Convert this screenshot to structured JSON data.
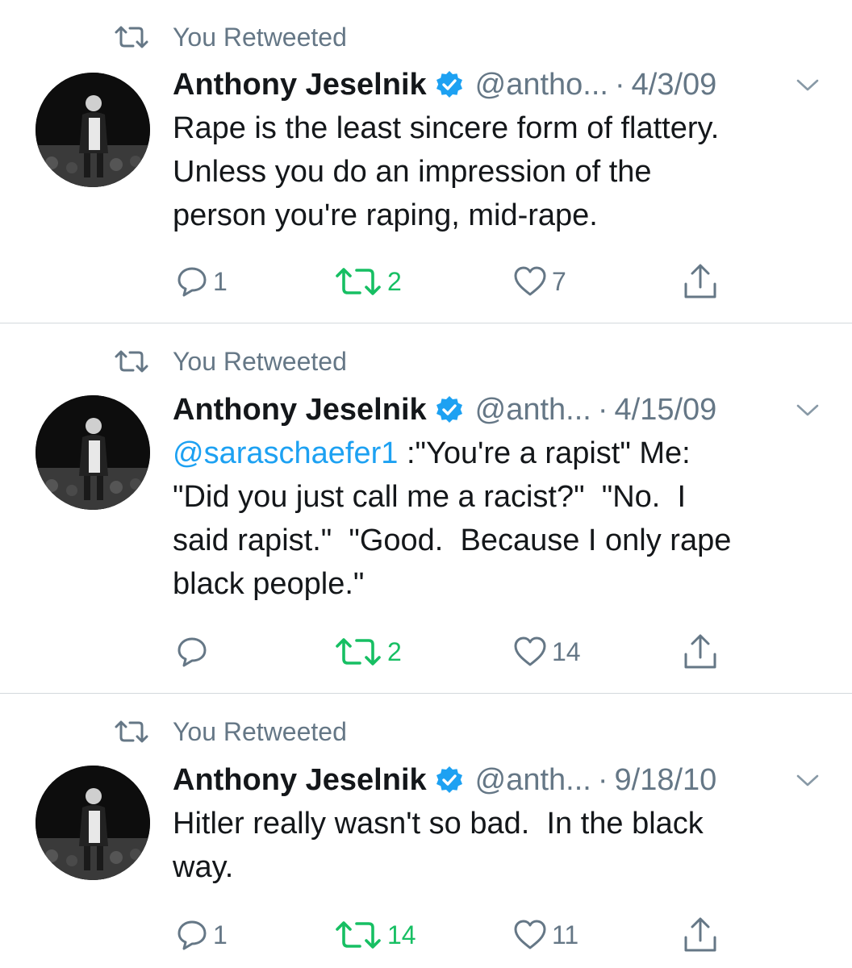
{
  "colors": {
    "accent": "#1da1f2",
    "retweeted": "#17bf63",
    "secondary": "#657786"
  },
  "tweets": [
    {
      "retweet_label": "You Retweeted",
      "name": "Anthony Jeselnik",
      "handle": "@antho...",
      "separator": "·",
      "date": "4/3/09",
      "mention": "",
      "lines": [
        "Rape is the least sincere form of flattery.",
        "Unless you do an impression of the",
        "person you're raping, mid-rape."
      ],
      "reply_count": "1",
      "retweet_count": "2",
      "like_count": "7"
    },
    {
      "retweet_label": "You Retweeted",
      "name": "Anthony Jeselnik",
      "handle": "@anth...",
      "separator": "·",
      "date": "4/15/09",
      "mention": "@saraschaefer1",
      "first_line_rest": " :\"You're a rapist\" Me:",
      "lines": [
        "\"Did you just call me a racist?\"  \"No.  I",
        "said rapist.\"  \"Good.  Because I only rape",
        "black people.\""
      ],
      "reply_count": "",
      "retweet_count": "2",
      "like_count": "14"
    },
    {
      "retweet_label": "You Retweeted",
      "name": "Anthony Jeselnik",
      "handle": "@anth...",
      "separator": "·",
      "date": "9/18/10",
      "mention": "",
      "lines": [
        "Hitler really wasn't so bad.  In the black",
        "way."
      ],
      "reply_count": "1",
      "retweet_count": "14",
      "like_count": "11"
    }
  ]
}
